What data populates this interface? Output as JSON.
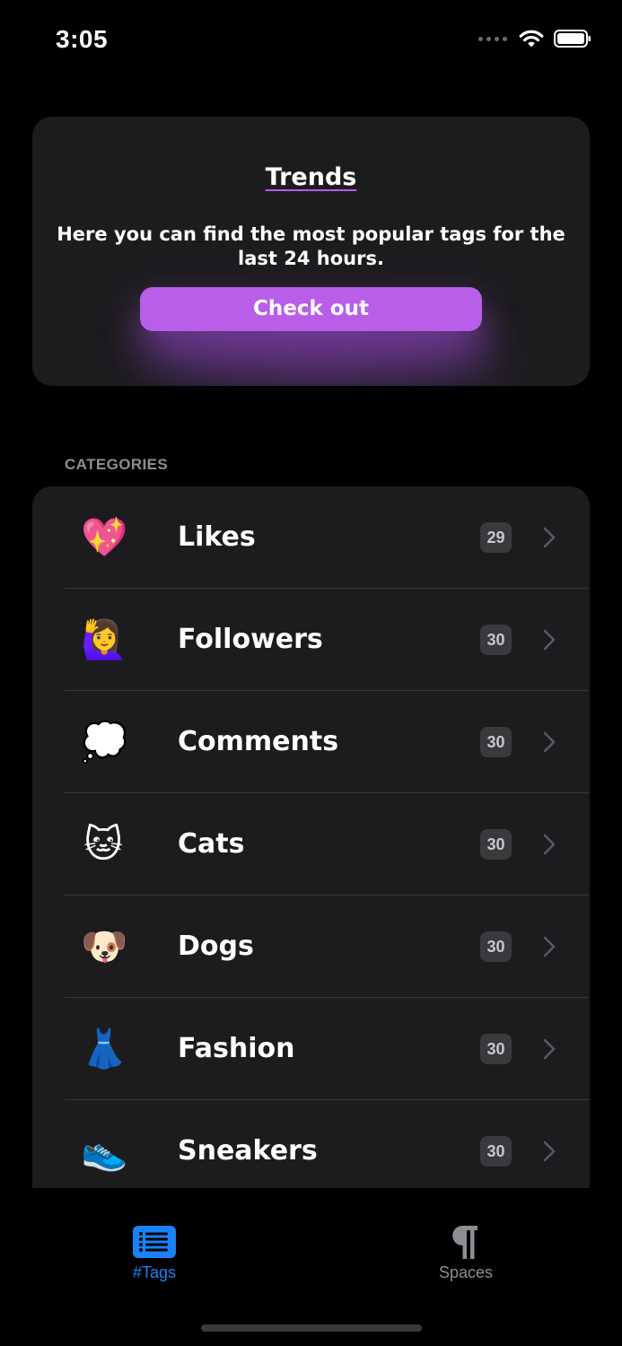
{
  "status_bar": {
    "time": "3:05"
  },
  "trends": {
    "title": "Trends",
    "description": "Here you can find the most popular tags for the last 24 hours.",
    "button_label": "Check out"
  },
  "categories_header": "CATEGORIES",
  "categories": [
    {
      "emoji": "💖",
      "label": "Likes",
      "count": "29"
    },
    {
      "emoji": "🙋‍♀️",
      "label": "Followers",
      "count": "30"
    },
    {
      "emoji": "💭",
      "label": "Comments",
      "count": "30"
    },
    {
      "emoji": "🐱",
      "label": "Cats",
      "count": "30"
    },
    {
      "emoji": "🐶",
      "label": "Dogs",
      "count": "30"
    },
    {
      "emoji": "👗",
      "label": "Fashion",
      "count": "30"
    },
    {
      "emoji": "👟",
      "label": "Sneakers",
      "count": "30"
    }
  ],
  "tabs": [
    {
      "label": "#Tags",
      "icon": "list-icon",
      "active": true
    },
    {
      "label": "Spaces",
      "icon": "pilcrow-icon",
      "active": false
    }
  ],
  "colors": {
    "accent": "#b85ee9",
    "tab_active": "#1a82f7",
    "card_bg": "#1c1c1e",
    "badge_bg": "#3a3a3c"
  }
}
